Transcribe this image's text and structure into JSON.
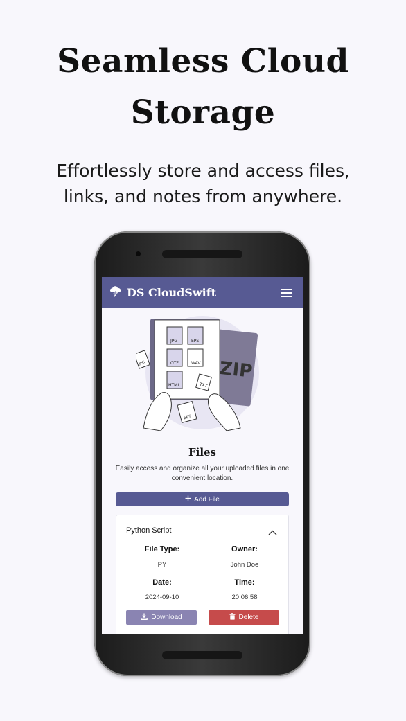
{
  "hero": {
    "title_line1": "Seamless Cloud",
    "title_line2": "Storage",
    "subtitle_line1": "Effortlessly store and access files,",
    "subtitle_line2": "links, and notes from anywhere."
  },
  "app": {
    "title": "DS CloudSwift",
    "logo_icon": "cloud-bolt-icon",
    "menu_icon": "hamburger-menu-icon",
    "accent_color": "#575a93"
  },
  "illustration": {
    "labels": [
      "JPG",
      "EPS",
      "OTF",
      "WAV",
      "HTML",
      "TXT",
      "ZIP",
      "EPS",
      "JPG"
    ]
  },
  "files_section": {
    "title": "Files",
    "description": "Easily access and organize all your uploaded files in one convenient location.",
    "add_button_label": "Add File",
    "add_icon": "plus-icon"
  },
  "file_card": {
    "name": "Python Script",
    "expand_icon": "chevron-up-icon",
    "file_type_label": "File Type:",
    "file_type_value": "PY",
    "owner_label": "Owner:",
    "owner_value": "John Doe",
    "date_label": "Date:",
    "date_value": "2024-09-10",
    "time_label": "Time:",
    "time_value": "20:06:58",
    "download_label": "Download",
    "delete_label": "Delete",
    "download_color": "#8a84b2",
    "delete_color": "#c64b4b"
  }
}
